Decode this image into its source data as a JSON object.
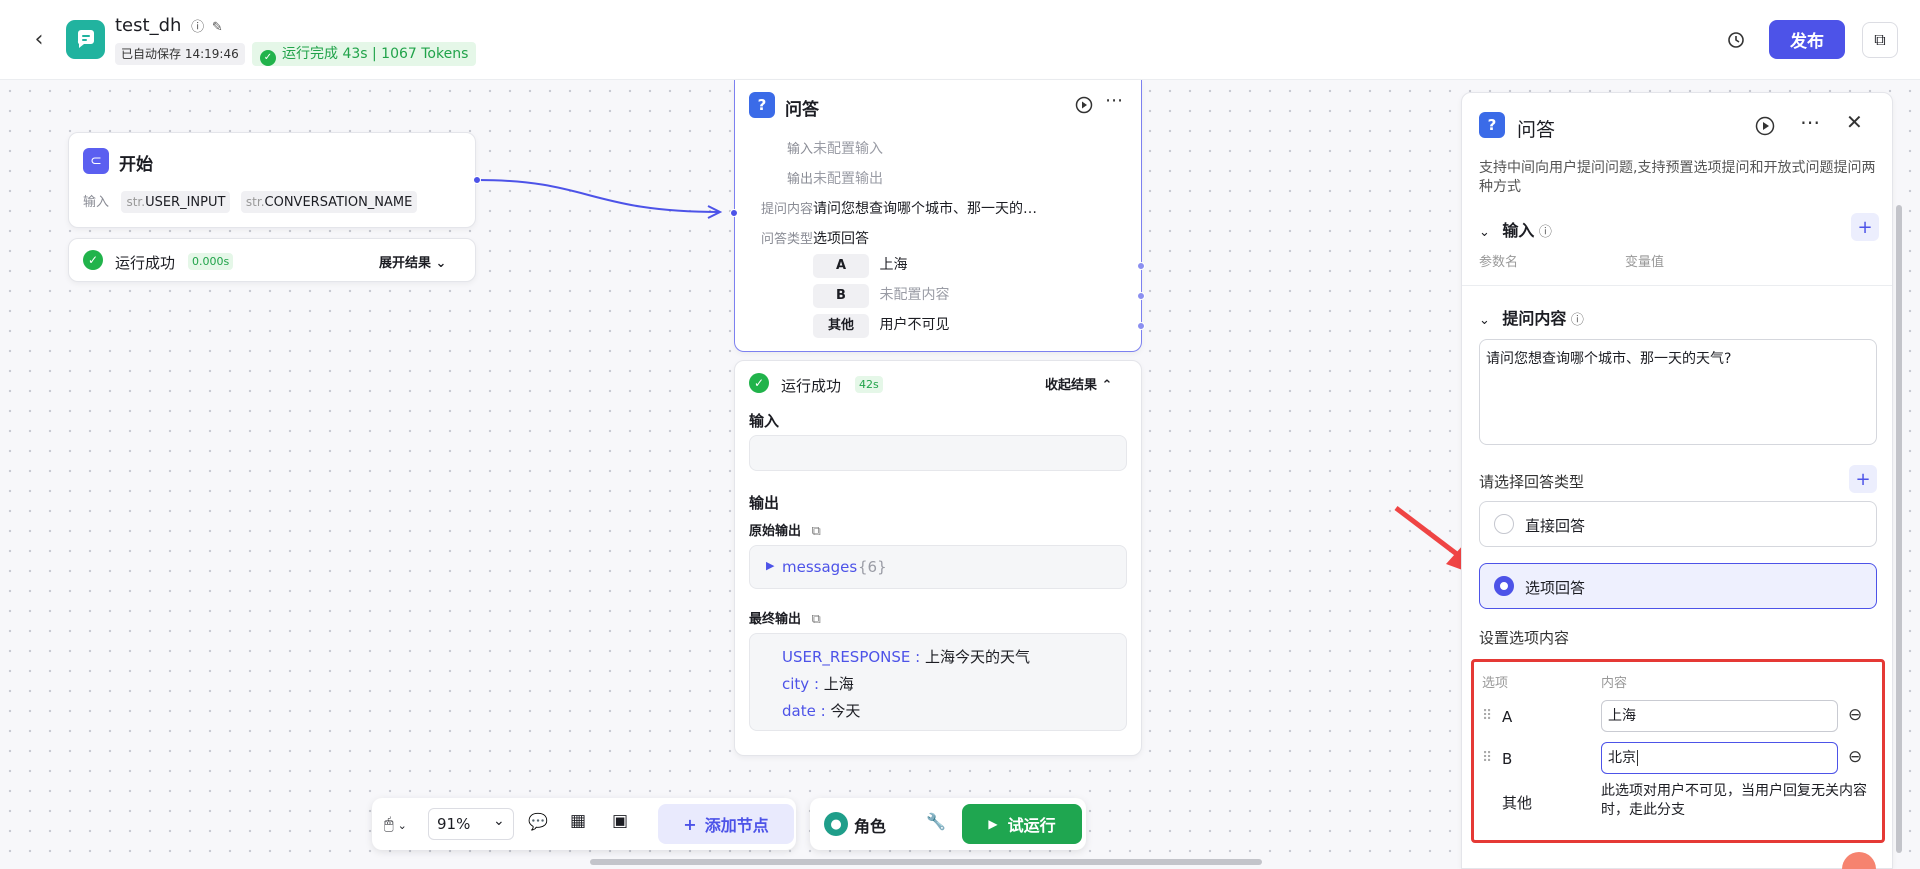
{
  "header": {
    "app_title": "test_dh",
    "autosave": "已自动保存 14:19:46",
    "run_status": "运行完成 43s | 1067 Tokens",
    "publish": "发布"
  },
  "start_node": {
    "title": "开始",
    "input_label": "输入",
    "params": [
      {
        "type": "str.",
        "name": "USER_INPUT"
      },
      {
        "type": "str.",
        "name": "CONVERSATION_NAME"
      }
    ],
    "result_status": "运行成功",
    "result_time": "0.000s",
    "expand": "展开结果"
  },
  "qa_node": {
    "title": "问答",
    "rows": [
      {
        "label": "输入",
        "value": "未配置输入",
        "dim": true
      },
      {
        "label": "输出",
        "value": "未配置输出",
        "dim": true
      },
      {
        "label": "提问内容",
        "value": "请问您想查询哪个城市、那一天的…",
        "dim": false
      },
      {
        "label": "问答类型",
        "value": "选项回答",
        "dim": false
      }
    ],
    "options": [
      {
        "key": "A",
        "value": "上海",
        "dim": false
      },
      {
        "key": "B",
        "value": "未配置内容",
        "dim": true
      },
      {
        "key": "其他",
        "value": "用户不可见",
        "dim": false
      }
    ]
  },
  "qa_result": {
    "status": "运行成功",
    "time": "42s",
    "collapse": "收起结果",
    "input_title": "输入",
    "output_title": "输出",
    "raw_output_label": "原始输出",
    "raw_key": "messages",
    "raw_count": "{6}",
    "final_output_label": "最终输出",
    "final": [
      {
        "key": "USER_RESPONSE",
        "value": "上海今天的天气"
      },
      {
        "key": "city",
        "value": "上海"
      },
      {
        "key": "date",
        "value": "今天"
      }
    ]
  },
  "toolbar": {
    "zoom": "91%",
    "add_node": "添加节点",
    "role": "角色",
    "trial_run": "试运行"
  },
  "panel": {
    "title": "问答",
    "desc": "支持中间向用户提问问题,支持预置选项提问和开放式问题提问两种方式",
    "input_section": "输入",
    "param_col": "参数名",
    "var_col": "变量值",
    "question_section": "提问内容",
    "question_text": "请问您想查询哪个城市、那一天的天气?",
    "answer_type_label": "请选择回答类型",
    "answer_types": [
      {
        "label": "直接回答",
        "selected": false
      },
      {
        "label": "选项回答",
        "selected": true
      }
    ],
    "option_content_label": "设置选项内容",
    "col_option": "选项",
    "col_content": "内容",
    "options": [
      {
        "key": "A",
        "value": "上海"
      },
      {
        "key": "B",
        "value": "北京"
      }
    ],
    "other_key": "其他",
    "other_desc": "此选项对用户不可见，当用户回复无关内容时，走此分支"
  },
  "colors": {
    "accent": "#4d53e8",
    "success": "#21b34b",
    "highlight_border": "#e53935",
    "arrow": "#ef4444"
  }
}
